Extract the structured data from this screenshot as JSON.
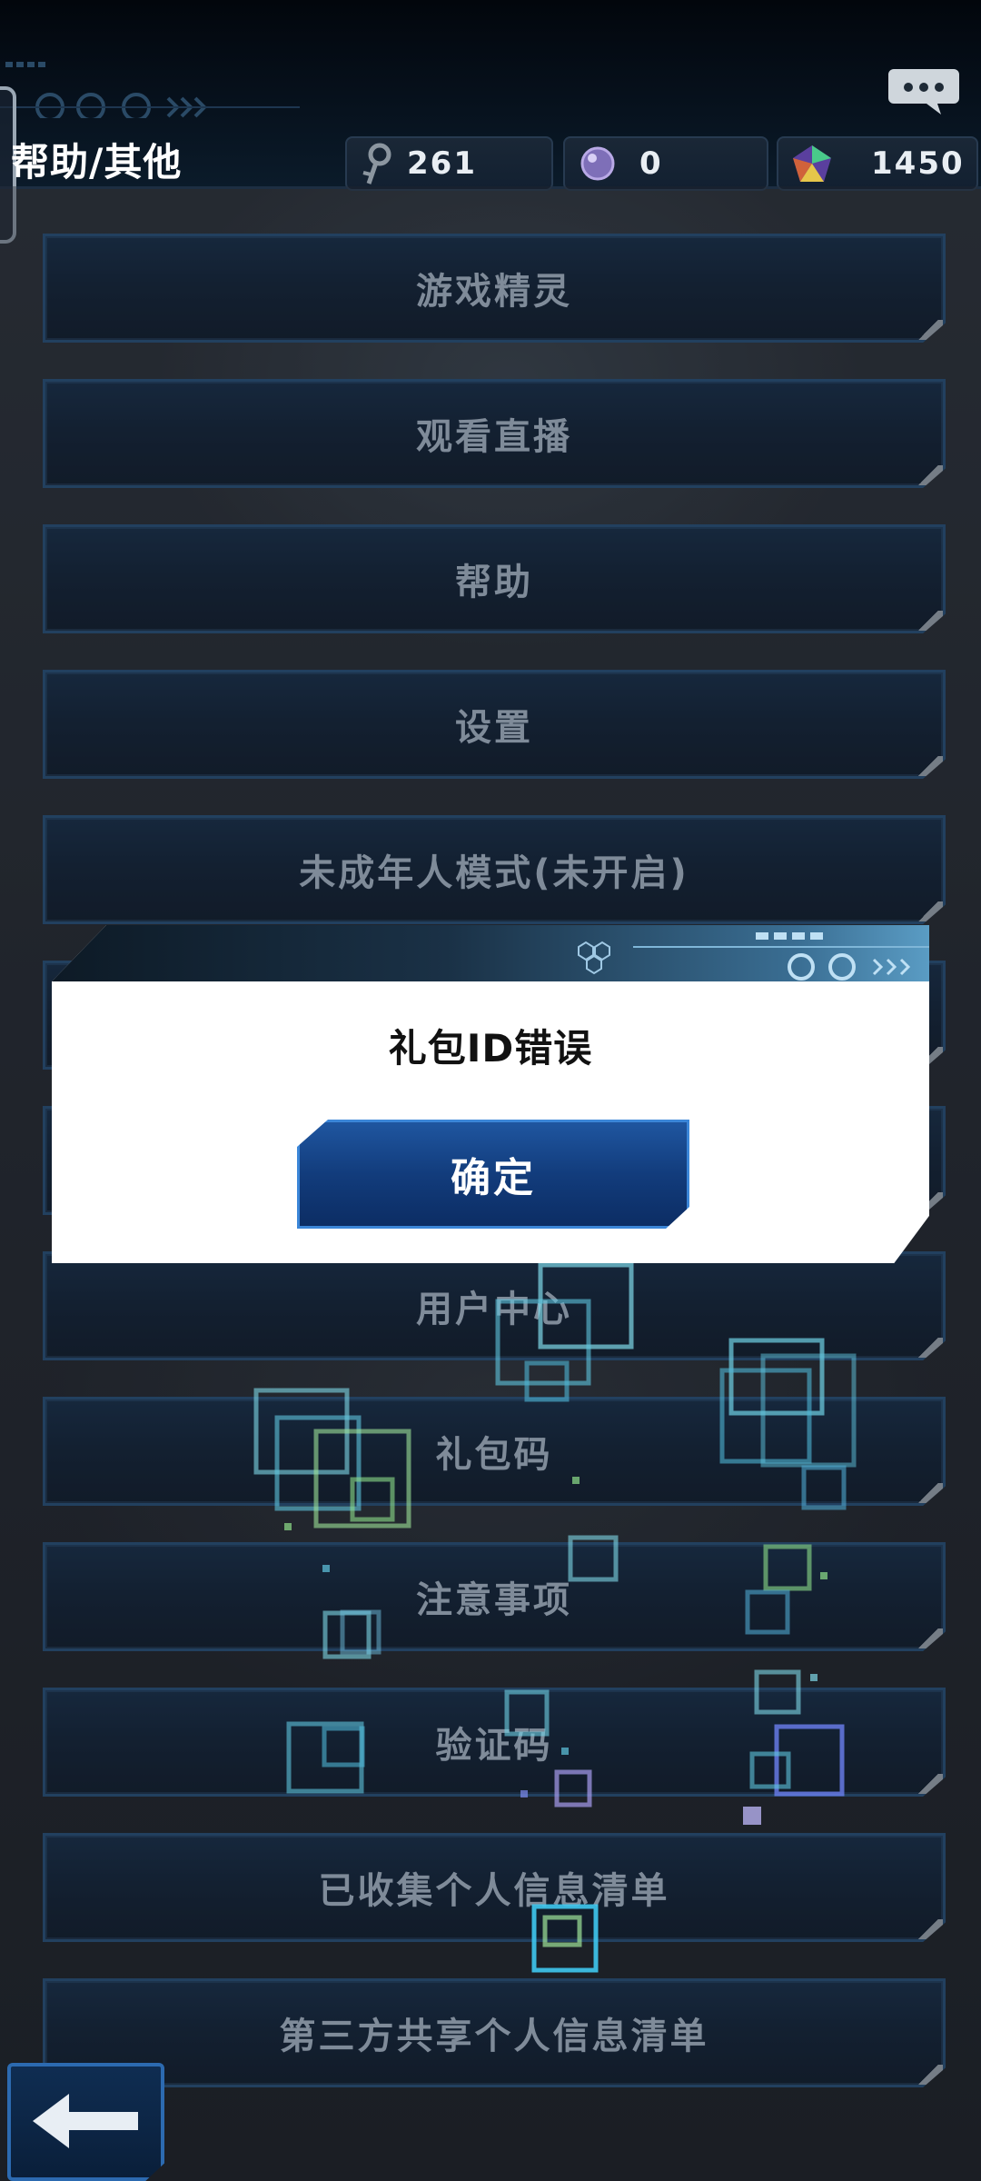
{
  "header": {
    "title": "帮助/其他",
    "currencies": [
      {
        "icon": "key-icon",
        "value": "261"
      },
      {
        "icon": "orb-icon",
        "value": "0"
      },
      {
        "icon": "gem-icon",
        "value": "1450"
      }
    ]
  },
  "menu": {
    "items": [
      {
        "label": "游戏精灵"
      },
      {
        "label": "观看直播"
      },
      {
        "label": "帮助"
      },
      {
        "label": "设置"
      },
      {
        "label": "未成年人模式(未开启)"
      },
      {
        "label": ""
      },
      {
        "label": ""
      },
      {
        "label": "用户中心"
      },
      {
        "label": "礼包码"
      },
      {
        "label": "注意事项"
      },
      {
        "label": "验证码"
      },
      {
        "label": "已收集个人信息清单"
      },
      {
        "label": "第三方共享个人信息清单"
      }
    ]
  },
  "dialog": {
    "message": "礼包ID错误",
    "confirm_label": "确定"
  },
  "colors": {
    "button_fill": "#0a1d33",
    "button_border": "#23527e",
    "accent": "#3b86d8"
  }
}
